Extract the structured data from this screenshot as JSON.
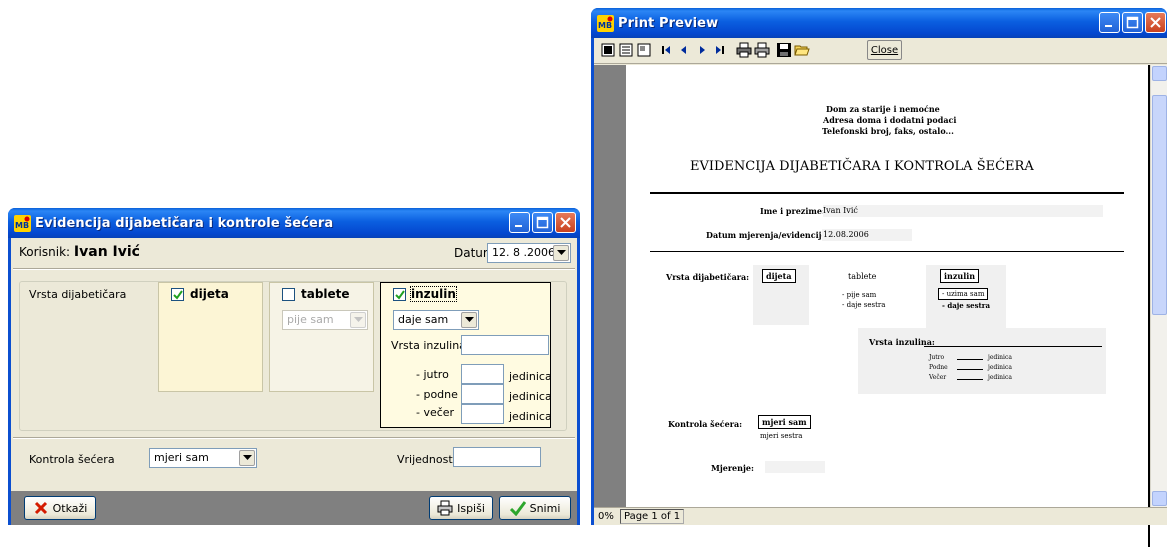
{
  "form_window": {
    "title": "Evidencija dijabetičara i kontrole šećera",
    "user_label": "Korisnik:",
    "user_name": "Ivan Ivić",
    "date_label": "Datum:",
    "date_value": "12. 8 .2006",
    "type_label": "Vrsta dijabetičara",
    "options": [
      {
        "label": "dijeta",
        "checked": true
      },
      {
        "label": "tablete",
        "checked": false,
        "combo": "pije sam"
      },
      {
        "label": "inzulin",
        "checked": true,
        "combo": "daje sam"
      }
    ],
    "insulin_type_label": "Vrsta inzulina:",
    "doses": [
      {
        "label": "- jutro",
        "unit": "jedinica"
      },
      {
        "label": "- podne",
        "unit": "jedinica"
      },
      {
        "label": "- večer",
        "unit": "jedinica"
      }
    ],
    "sugar_control_label": "Kontrola šećera",
    "sugar_control_value": "mjeri sam",
    "value_label": "Vrijednost:",
    "buttons": {
      "cancel": "Otkaži",
      "print": "Ispiši",
      "save": "Snimi"
    }
  },
  "preview_window": {
    "title": "Print Preview",
    "close_button": "Close",
    "status_zoom": "0%",
    "status_page": "Page 1 of 1",
    "report": {
      "header_lines": [
        "Dom za starije i nemoćne",
        "Adresa doma i dodatni podaci",
        "Telefonski broj, faks, ostalo..."
      ],
      "title": "EVIDENCIJA DIJABETIČARA I KONTROLA ŠEĆERA",
      "name_label": "Ime i prezime:",
      "name_value": "Ivan Ivić",
      "date_label": "Datum mjerenja/evidencije:",
      "date_value": "12.08.2006",
      "type_label": "Vrsta dijabetičara:",
      "dijeta": "dijeta",
      "tablete": "tablete",
      "tablete_opts": [
        "- pije sam",
        "- daje sestra"
      ],
      "inzulin": "inzulin",
      "inzulin_opts": [
        "- uzima sam",
        "- daje sestra"
      ],
      "insulin_type_label": "Vrsta inzulina:",
      "doses": [
        {
          "label": "Jutro",
          "unit": "jedinica"
        },
        {
          "label": "Podne",
          "unit": "jedinica"
        },
        {
          "label": "Večer",
          "unit": "jedinica"
        }
      ],
      "control_label": "Kontrola šećera:",
      "control_opts": [
        "mjeri sam",
        "mjeri sestra"
      ],
      "measure_label": "Mjerenje:"
    }
  },
  "colors": {
    "title_blue": "#0b4fd0",
    "window_bg": "#ece9d8",
    "panel_yellow": "#fffbe1",
    "bottom_bar": "#808080"
  }
}
